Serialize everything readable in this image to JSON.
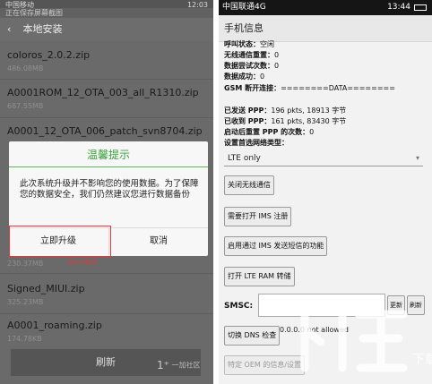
{
  "left": {
    "status_carrier": "中国移动",
    "status_time": "12:03",
    "notice": "正在保存屏幕截图",
    "header_title": "本地安装",
    "files": [
      {
        "name": "coloros_2.0.2.zip",
        "size": "486.08MB"
      },
      {
        "name": "A0001ROM_12_OTA_003_all_R1310.zip",
        "size": "687.55MB"
      },
      {
        "name": "A0001_12_OTA_006_patch_svn8704.zip",
        "size": ""
      },
      {
        "name": "",
        "size": "230.37MB"
      },
      {
        "name": "Signed_MIUI.zip",
        "size": "325.23MB"
      },
      {
        "name": "A0001_roaming.zip",
        "size": "174.78KB"
      }
    ],
    "dialog": {
      "title": "温馨提示",
      "message": "此次系统升级并不影响您的使用数据。为了保障您的数据安全，我们仍然建议您进行数据备份",
      "confirm_label": "立即升级",
      "cancel_label": "取消"
    },
    "red_note": "Bob 点此项",
    "refresh_label": "刷新",
    "watermark": "一加社区"
  },
  "right": {
    "status_carrier": "中国联通4G",
    "status_time": "13:44",
    "header_title": "手机信息",
    "rows": [
      {
        "key": "呼叫状态：",
        "value": "空闲"
      },
      {
        "key": "无线通信重置：",
        "value": "0"
      },
      {
        "key": "数据尝试次数：",
        "value": "0"
      },
      {
        "key": "数据成功：",
        "value": "0"
      },
      {
        "key": "GSM 断开连接：",
        "value": "========DATA========"
      }
    ],
    "rows2": [
      {
        "key": "已发送 PPP：",
        "value": "196 pkts, 18913 字节"
      },
      {
        "key": "已收到 PPP：",
        "value": "161 pkts, 83430 字节"
      },
      {
        "key": "启动后重置 PPP 的次数：",
        "value": "0"
      },
      {
        "key": "设置首选网络类型：",
        "value": ""
      }
    ],
    "network_type": "LTE only",
    "buttons": [
      "关闭无线通信",
      "需要打开 IMS 注册",
      "启用通过 IMS 发送短信的功能",
      "打开 LTE RAM 转储"
    ],
    "smsc_label": "SMSC:",
    "update_label": "更新",
    "refresh_label": "刷新",
    "dns_button": "切换 DNS 检查",
    "dns_status": "0.0.0.0 not allowed",
    "oem_button": "特定 OEM 的信息/设置"
  },
  "watermark_big": "下载吧",
  "colors": {
    "dialog_title": "#3aa03a",
    "highlight": "#e33333",
    "right_status_bar": "#151515"
  }
}
